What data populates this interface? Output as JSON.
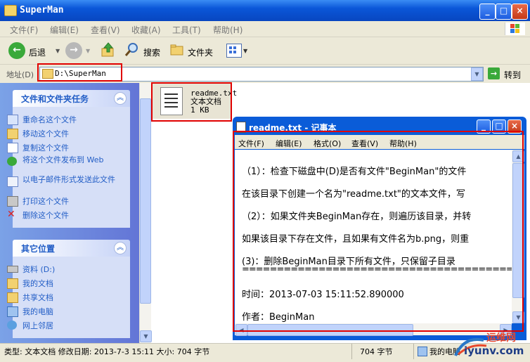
{
  "window": {
    "title": "SuperMan"
  },
  "menu": {
    "items": [
      "文件(F)",
      "编辑(E)",
      "查看(V)",
      "收藏(A)",
      "工具(T)",
      "帮助(H)"
    ]
  },
  "toolbar": {
    "back_label": "后退",
    "search_label": "搜索",
    "folders_label": "文件夹"
  },
  "address": {
    "label": "地址(D)",
    "value": "D:\\SuperMan",
    "go_label": "转到"
  },
  "tasks_panel": {
    "title": "文件和文件夹任务",
    "items": [
      "重命名这个文件",
      "移动这个文件",
      "复制这个文件",
      "将这个文件发布到 Web",
      "以电子邮件形式发送此文件",
      "打印这个文件",
      "删除这个文件"
    ]
  },
  "places_panel": {
    "title": "其它位置",
    "items": [
      "资料 (D:)",
      "我的文档",
      "共享文档",
      "我的电脑",
      "网上邻居"
    ]
  },
  "file": {
    "name": "readme.txt",
    "type": "文本文档",
    "size": "1 KB"
  },
  "notepad": {
    "title": "readme.txt - 记事本",
    "menu": [
      "文件(F)",
      "编辑(E)",
      "格式(O)",
      "查看(V)",
      "帮助(H)"
    ],
    "lines": [
      "（1）：检查下磁盘中(D)是否有文件\"BeginMan\"的文件",
      "在该目录下创建一个名为\"readme.txt\"的文本文件，写",
      "（2）：如果文件夹BeginMan存在，则遍历该目录，并转",
      "如果该目录下存在文件，且如果有文件名为b.png，则重",
      "(3)：删除BeginMan目录下所有文件，只保留子目录",
      "========================================",
      "时间：2013-07-03 15:11:52.890000",
      "作者：BeginMan"
    ]
  },
  "status": {
    "left": "类型: 文本文档 修改日期: 2013-7-3 15:11 大小: 704 字节",
    "size": "704 字节",
    "location": "我的电脑"
  },
  "watermark": {
    "line1": "运维网",
    "line2": "iyunv.com"
  }
}
